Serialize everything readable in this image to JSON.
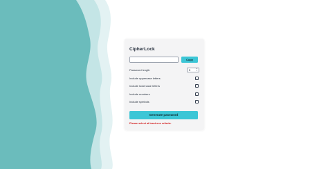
{
  "app": {
    "title": "CipherLock"
  },
  "password_field": {
    "value": "",
    "placeholder": ""
  },
  "copy_button": {
    "label": "Copy"
  },
  "options": {
    "length_label": "Password length",
    "length_value": "5",
    "uppercase_label": "Include uppercase letters",
    "uppercase_checked": false,
    "lowercase_label": "Include lowercase letters",
    "lowercase_checked": false,
    "numbers_label": "Include numbers",
    "numbers_checked": false,
    "symbols_label": "Include symbols",
    "symbols_checked": false
  },
  "generate_button": {
    "label": "Generate password"
  },
  "error": {
    "message": "Please select at least one criteria."
  },
  "colors": {
    "accent": "#3cc6d6",
    "background_wave": "#6bbcbc",
    "error": "#d11a1a",
    "card": "#f4f4f5"
  },
  "icons": {
    "spin_up": "triangle-up",
    "spin_down": "triangle-down"
  }
}
